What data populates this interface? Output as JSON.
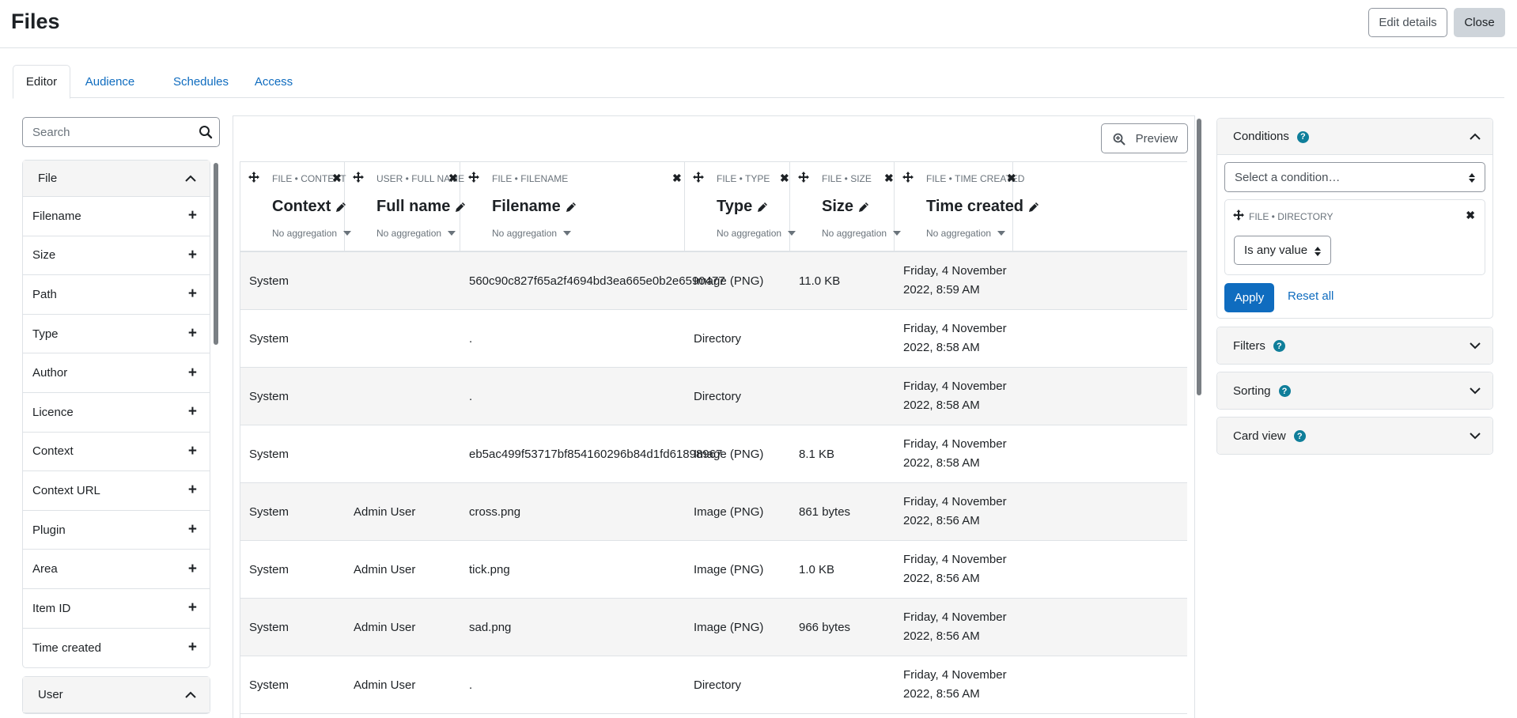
{
  "page": {
    "title": "Files",
    "edit_details_label": "Edit details",
    "close_label": "Close"
  },
  "tabs": [
    {
      "label": "Editor",
      "active": true
    },
    {
      "label": "Audience",
      "active": false
    },
    {
      "label": "Schedules",
      "active": false
    },
    {
      "label": "Access",
      "active": false
    }
  ],
  "sidebar": {
    "search_placeholder": "Search",
    "file_section": {
      "title": "File",
      "items": [
        "Filename",
        "Size",
        "Path",
        "Type",
        "Author",
        "Licence",
        "Context",
        "Context URL",
        "Plugin",
        "Area",
        "Item ID",
        "Time created"
      ]
    },
    "user_section": {
      "title": "User"
    }
  },
  "main": {
    "preview_label": "Preview",
    "aggregation_label": "No aggregation",
    "columns": [
      {
        "source": "FILE • CONTEXT",
        "title": "Context"
      },
      {
        "source": "USER • FULL NAME",
        "title": "Full name"
      },
      {
        "source": "FILE • FILENAME",
        "title": "Filename"
      },
      {
        "source": "FILE • TYPE",
        "title": "Type"
      },
      {
        "source": "FILE • SIZE",
        "title": "Size"
      },
      {
        "source": "FILE • TIME CREATED",
        "title": "Time created"
      }
    ],
    "rows": [
      [
        "System",
        "",
        "560c90c827f65a2f4694bd3ea665e0b2e6590477",
        "Image (PNG)",
        "11.0 KB",
        "Friday, 4 November 2022, 8:59 AM"
      ],
      [
        "System",
        "",
        ".",
        "Directory",
        "",
        "Friday, 4 November 2022, 8:58 AM"
      ],
      [
        "System",
        "",
        ".",
        "Directory",
        "",
        "Friday, 4 November 2022, 8:58 AM"
      ],
      [
        "System",
        "",
        "eb5ac499f53717bf854160296b84d1fd61898967",
        "Image (PNG)",
        "8.1 KB",
        "Friday, 4 November 2022, 8:58 AM"
      ],
      [
        "System",
        "Admin User",
        "cross.png",
        "Image (PNG)",
        "861 bytes",
        "Friday, 4 November 2022, 8:56 AM"
      ],
      [
        "System",
        "Admin User",
        "tick.png",
        "Image (PNG)",
        "1.0 KB",
        "Friday, 4 November 2022, 8:56 AM"
      ],
      [
        "System",
        "Admin User",
        "sad.png",
        "Image (PNG)",
        "966 bytes",
        "Friday, 4 November 2022, 8:56 AM"
      ],
      [
        "System",
        "Admin User",
        ".",
        "Directory",
        "",
        "Friday, 4 November 2022, 8:56 AM"
      ]
    ]
  },
  "conditions": {
    "title": "Conditions",
    "select_placeholder": "Select a condition…",
    "condition_source": "FILE • DIRECTORY",
    "condition_value": "Is any value",
    "apply_label": "Apply",
    "reset_label": "Reset all"
  },
  "other_panels": [
    {
      "title": "Filters"
    },
    {
      "title": "Sorting"
    },
    {
      "title": "Card view"
    }
  ],
  "colors": {
    "accent": "#0f6cbf",
    "help": "#0f7e9a",
    "row_alt": "#f5f5f5",
    "border": "#dee2e6"
  }
}
